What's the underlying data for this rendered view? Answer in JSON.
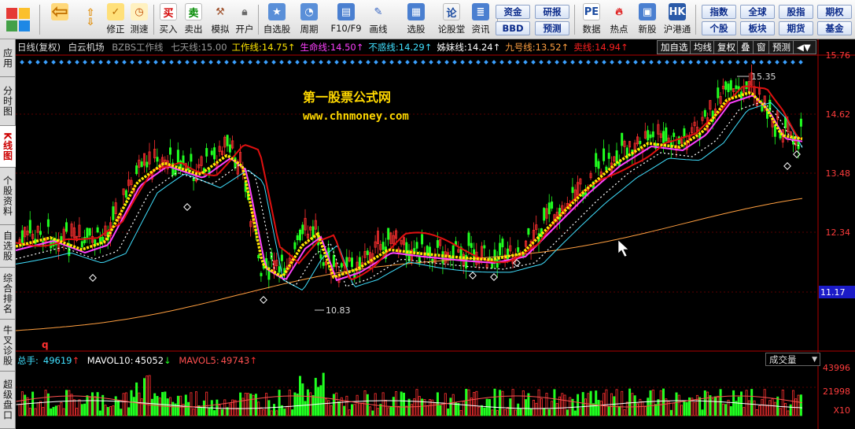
{
  "toolbar": {
    "buttons": [
      {
        "name": "back-button",
        "icon": "left-arrow-icon",
        "label": ""
      },
      {
        "name": "up-down-button",
        "icon": "up-down-arrow-icon",
        "label": ""
      },
      {
        "name": "modify-button",
        "icon": "check-circle-icon",
        "label": "修正"
      },
      {
        "name": "test-button",
        "icon": "clock-icon",
        "label": "测速"
      },
      {
        "name": "buy-button",
        "icon": "buy-icon",
        "label": "买入",
        "glyph": "买"
      },
      {
        "name": "sell-button",
        "icon": "sell-icon",
        "label": "卖出",
        "glyph": "卖"
      },
      {
        "name": "simulate-button",
        "icon": "hammer-icon",
        "label": "模拟"
      },
      {
        "name": "open-account-button",
        "icon": "lock-icon",
        "label": "开户"
      },
      {
        "name": "watchlist-button",
        "icon": "star-icon",
        "label": "自选股"
      },
      {
        "name": "period-button",
        "icon": "chart-cycle-icon",
        "label": "周期"
      },
      {
        "name": "f10-button",
        "icon": "document-icon",
        "label": "F10/F9"
      },
      {
        "name": "draw-button",
        "icon": "pen-icon",
        "label": "画线"
      },
      {
        "name": "select-stock-button",
        "icon": "screen-icon",
        "label": "选股"
      },
      {
        "name": "forum-button",
        "icon": "lun-icon",
        "label": "论股堂",
        "glyph": "论"
      },
      {
        "name": "news-button",
        "icon": "news-icon",
        "label": "资讯"
      },
      {
        "name": "data-button",
        "icon": "pe-icon",
        "label": "数据",
        "glyph": "PE"
      },
      {
        "name": "hotspot-button",
        "icon": "hot-icon",
        "label": "热点"
      },
      {
        "name": "new-stock-button",
        "icon": "new-stock-icon",
        "label": "新股"
      },
      {
        "name": "hk-connect-button",
        "icon": "sh-hk-icon",
        "label": "沪港通"
      }
    ],
    "pills": [
      {
        "name": "funds-pill",
        "label": "资金"
      },
      {
        "name": "bbd-pill",
        "label": "BBD"
      },
      {
        "name": "research-pill",
        "label": "研报"
      },
      {
        "name": "forecast-pill",
        "label": "预测"
      },
      {
        "name": "index-pill",
        "label": "指数"
      },
      {
        "name": "individual-pill",
        "label": "个股"
      },
      {
        "name": "global-pill",
        "label": "全球"
      },
      {
        "name": "sector-pill",
        "label": "板块"
      },
      {
        "name": "bonds-pill",
        "label": "股指"
      },
      {
        "name": "futures-pill",
        "label": "期货"
      },
      {
        "name": "options-pill",
        "label": "期权"
      },
      {
        "name": "fund-pill",
        "label": "基金"
      }
    ]
  },
  "sidetabs": [
    {
      "label": "应用",
      "active": false
    },
    {
      "label": "分时图",
      "active": false
    },
    {
      "label": "K线图",
      "active": true
    },
    {
      "label": "个股资料",
      "active": false
    },
    {
      "label": "自选股",
      "active": false
    },
    {
      "label": "综合排名",
      "active": false
    },
    {
      "label": "牛叉诊股",
      "active": false
    },
    {
      "label": "超级盘口",
      "active": false
    }
  ],
  "header": {
    "period": "日线(复权)",
    "stock_name": "白云机场",
    "indicator_name": "BZBS工作线",
    "lines": [
      {
        "label": "七天线:",
        "value": "15.00",
        "arrow": "",
        "color": "#9a9a9a"
      },
      {
        "label": "工作线:",
        "value": "14.75",
        "arrow": "↑",
        "color": "#ffe600"
      },
      {
        "label": "生命线:",
        "value": "14.50",
        "arrow": "↑",
        "color": "#ff40ff"
      },
      {
        "label": "不惑线:",
        "value": "14.29",
        "arrow": "↑",
        "color": "#40e0ff"
      },
      {
        "label": "姊妹线:",
        "value": "14.24",
        "arrow": "↑",
        "color": "#ffffff"
      },
      {
        "label": "九号线:",
        "value": "13.52",
        "arrow": "↑",
        "color": "#ff9f40"
      },
      {
        "label": "卖线:",
        "value": "14.94",
        "arrow": "↑",
        "color": "#ff2020"
      }
    ]
  },
  "controls": [
    "加自选",
    "均线",
    "复权",
    "叠",
    "窗",
    "预测"
  ],
  "watermark": {
    "title": "第一股票公式网",
    "url": "www.chnmoney.com"
  },
  "price_axis": [
    "15.76",
    "14.62",
    "13.48",
    "12.34",
    "11.17"
  ],
  "current_price": "11.17",
  "annotations": {
    "high": "15.35",
    "low": "10.83",
    "marker": "q"
  },
  "volume": {
    "total_label": "总手:",
    "total_value": "49619",
    "total_arrow": "↑",
    "mavol10_label": "MAVOL10:",
    "mavol10_value": "45052",
    "mavol10_arrow": "↓",
    "mavol5_label": "MAVOL5:",
    "mavol5_value": "49743",
    "mavol5_arrow": "↑",
    "dropdown": "成交量",
    "axis": [
      "43996",
      "21998",
      "X10"
    ]
  },
  "colors": {
    "up": "#ff3030",
    "down": "#20ff20",
    "work_line": "#ffe600",
    "life_line": "#ff40ff",
    "sell_line": "#e01010"
  }
}
